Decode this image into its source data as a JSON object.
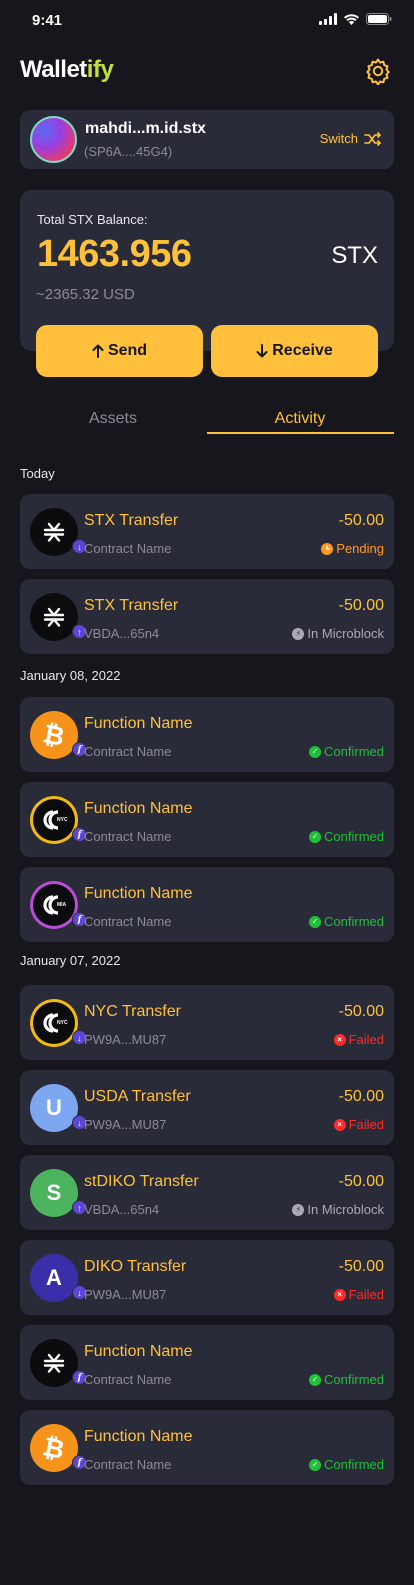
{
  "status_bar": {
    "time": "9:41"
  },
  "brand": {
    "name_pre": "Wallet",
    "name_accent": "ify"
  },
  "account": {
    "name": "mahdi...m.id.stx",
    "address": "(SP6A....45G4)",
    "switch_label": "Switch"
  },
  "balance": {
    "label": "Total STX Balance:",
    "amount": "1463.956",
    "unit": "STX",
    "usd": "~2365.32 USD"
  },
  "actions": {
    "send": "Send",
    "receive": "Receive"
  },
  "tabs": {
    "assets": "Assets",
    "activity": "Activity",
    "active": "activity"
  },
  "colors": {
    "accent": "#ffc13b",
    "card": "#2a2b38",
    "background": "#16161c",
    "confirmed": "#1fbf3a",
    "failed": "#ff2b2b",
    "pending": "#ff9a1f"
  },
  "groups": [
    {
      "date": "Today"
    },
    {
      "date": "January 08, 2022"
    },
    {
      "date": "January 07, 2022"
    }
  ],
  "transactions": [
    {
      "title": "STX Transfer",
      "subtitle": "Contract Name",
      "amount": "-50.00",
      "status": "Pending",
      "status_type": "pending",
      "icon": "stx-icon",
      "badge": "receive-arrow-icon"
    },
    {
      "title": "STX Transfer",
      "subtitle": "VBDA...65n4",
      "amount": "-50.00",
      "status": "In Microblock",
      "status_type": "micro",
      "icon": "stx-icon",
      "badge": "send-arrow-icon"
    },
    {
      "title": "Function Name",
      "subtitle": "Contract Name",
      "amount": "",
      "status": "Confirmed",
      "status_type": "confirmed",
      "icon": "bitcoin-icon",
      "badge": "function-icon"
    },
    {
      "title": "Function Name",
      "subtitle": "Contract Name",
      "amount": "",
      "status": "Confirmed",
      "status_type": "confirmed",
      "icon": "nyc-coin-icon",
      "ring_text": "NYC",
      "badge": "function-icon"
    },
    {
      "title": "Function Name",
      "subtitle": "Contract Name",
      "amount": "",
      "status": "Confirmed",
      "status_type": "confirmed",
      "icon": "mia-coin-icon",
      "ring_text": "MIA",
      "badge": "function-icon"
    },
    {
      "title": "NYC Transfer",
      "subtitle": "PW9A...MU87",
      "amount": "-50.00",
      "status": "Failed",
      "status_type": "failed",
      "icon": "nyc-coin-icon",
      "ring_text": "NYC",
      "badge": "receive-arrow-icon"
    },
    {
      "title": "USDA Transfer",
      "subtitle": "PW9A...MU87",
      "amount": "-50.00",
      "status": "Failed",
      "status_type": "failed",
      "icon": "usda-icon",
      "letter": "U",
      "badge": "receive-arrow-icon"
    },
    {
      "title": "stDIKO Transfer",
      "subtitle": "VBDA...65n4",
      "amount": "-50.00",
      "status": "In Microblock",
      "status_type": "micro",
      "icon": "stdiko-icon",
      "letter": "S",
      "badge": "send-arrow-icon"
    },
    {
      "title": "DIKO Transfer",
      "subtitle": "PW9A...MU87",
      "amount": "-50.00",
      "status": "Failed",
      "status_type": "failed",
      "icon": "diko-icon",
      "letter": "A",
      "badge": "receive-arrow-icon"
    },
    {
      "title": "Function Name",
      "subtitle": "Contract Name",
      "amount": "",
      "status": "Confirmed",
      "status_type": "confirmed",
      "icon": "stx-icon",
      "badge": "function-icon"
    },
    {
      "title": "Function Name",
      "subtitle": "Contract Name",
      "amount": "",
      "status": "Confirmed",
      "status_type": "confirmed",
      "icon": "bitcoin-icon",
      "badge": "function-icon"
    }
  ]
}
